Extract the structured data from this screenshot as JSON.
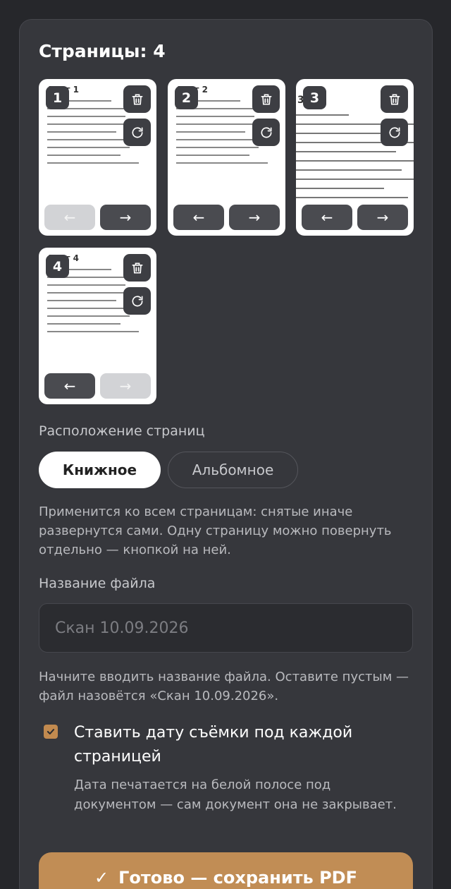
{
  "pages_title": "Страницы: 4",
  "pages": [
    {
      "badge": "1",
      "sheet_label": "Лист 1",
      "prev": "←",
      "next": "→",
      "prev_disabled": true,
      "next_disabled": false
    },
    {
      "badge": "2",
      "sheet_label": "Лист 2",
      "prev": "←",
      "next": "→",
      "prev_disabled": false,
      "next_disabled": false
    },
    {
      "badge": "3",
      "sheet_label": "3",
      "prev": "←",
      "next": "→",
      "prev_disabled": false,
      "next_disabled": false
    },
    {
      "badge": "4",
      "sheet_label": "Лист 4",
      "prev": "←",
      "next": "→",
      "prev_disabled": false,
      "next_disabled": true
    }
  ],
  "icons": {
    "delete": "trash-icon",
    "rotate": "rotate-icon"
  },
  "orientation": {
    "label": "Расположение страниц",
    "portrait": "Книжное",
    "landscape": "Альбомное",
    "selected": "Книжное",
    "hint": "Применится ко всем страницам: снятые иначе развернутся сами. Одну страницу можно повернуть отдельно — кнопкой на ней."
  },
  "filename": {
    "label": "Название файла",
    "placeholder": "Скан 10.09.2026",
    "value": "",
    "hint": "Начните вводить название файла. Оставите пустым — файл назовётся «Скан 10.09.2026»."
  },
  "date_option": {
    "checked": true,
    "label": "Ставить дату съёмки под каждой страницей",
    "description": "Дата печатается на белой полосе под документом — сам документ она не закрывает."
  },
  "done_button": {
    "icon": "check-icon",
    "label": "Готово — сохранить PDF"
  },
  "colors": {
    "accent": "#c18d55",
    "panel": "#36373c",
    "background": "#26272b"
  }
}
